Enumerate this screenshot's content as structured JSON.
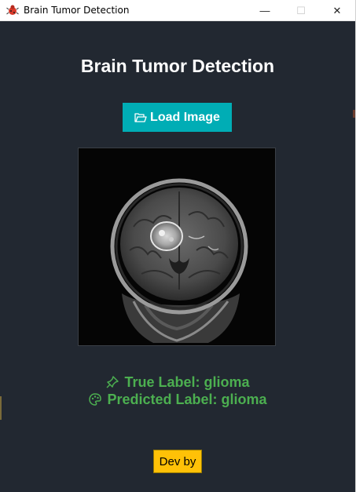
{
  "window": {
    "title": "Brain Tumor Detection",
    "controls": {
      "minimize": "—",
      "maximize": "☐",
      "close": "✕"
    }
  },
  "main": {
    "heading": "Brain Tumor Detection",
    "load_button_label": "Load Image",
    "true_label": "True Label: glioma",
    "predicted_label": "Predicted Label: glioma",
    "dev_button_label": "Dev by"
  },
  "colors": {
    "background": "#222831",
    "accent": "#00adb5",
    "label_green": "#4caf50",
    "dev_button": "#ffc107"
  },
  "icons": {
    "app": "bug-icon",
    "load": "folder-open-icon",
    "true_label": "pin-icon",
    "predicted_label": "palette-icon"
  }
}
